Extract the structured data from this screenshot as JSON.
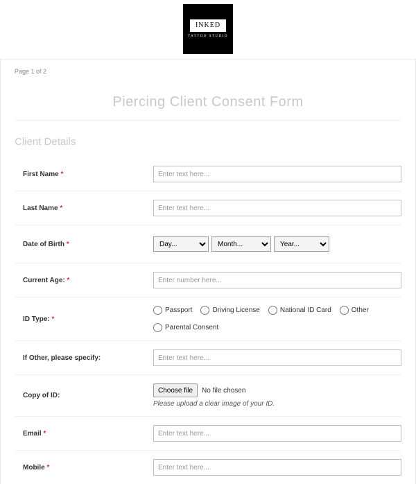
{
  "logo": {
    "line1": "INKED",
    "line2": "TATTOO STUDIO"
  },
  "page_indicator": "Page 1 of 2",
  "title": "Piercing Client Consent Form",
  "section_client_details": "Client Details",
  "required_mark": "*",
  "placeholders": {
    "text": "Enter text here...",
    "number": "Enter number here..."
  },
  "fields": {
    "first_name": {
      "label": "First Name"
    },
    "last_name": {
      "label": "Last Name"
    },
    "dob": {
      "label": "Date of Birth",
      "day": "Day...",
      "month": "Month...",
      "year": "Year..."
    },
    "current_age": {
      "label": "Current Age:"
    },
    "id_type": {
      "label": "ID Type:",
      "options": {
        "passport": "Passport",
        "driving": "Driving License",
        "national": "National ID Card",
        "other": "Other",
        "parental": "Parental Consent"
      }
    },
    "if_other": {
      "label": "If Other, please specify:"
    },
    "copy_id": {
      "label": "Copy of ID:",
      "button": "Choose file",
      "status": "No file chosen",
      "help": "Please upload a clear image of your ID."
    },
    "email": {
      "label": "Email"
    },
    "mobile": {
      "label": "Mobile"
    }
  }
}
